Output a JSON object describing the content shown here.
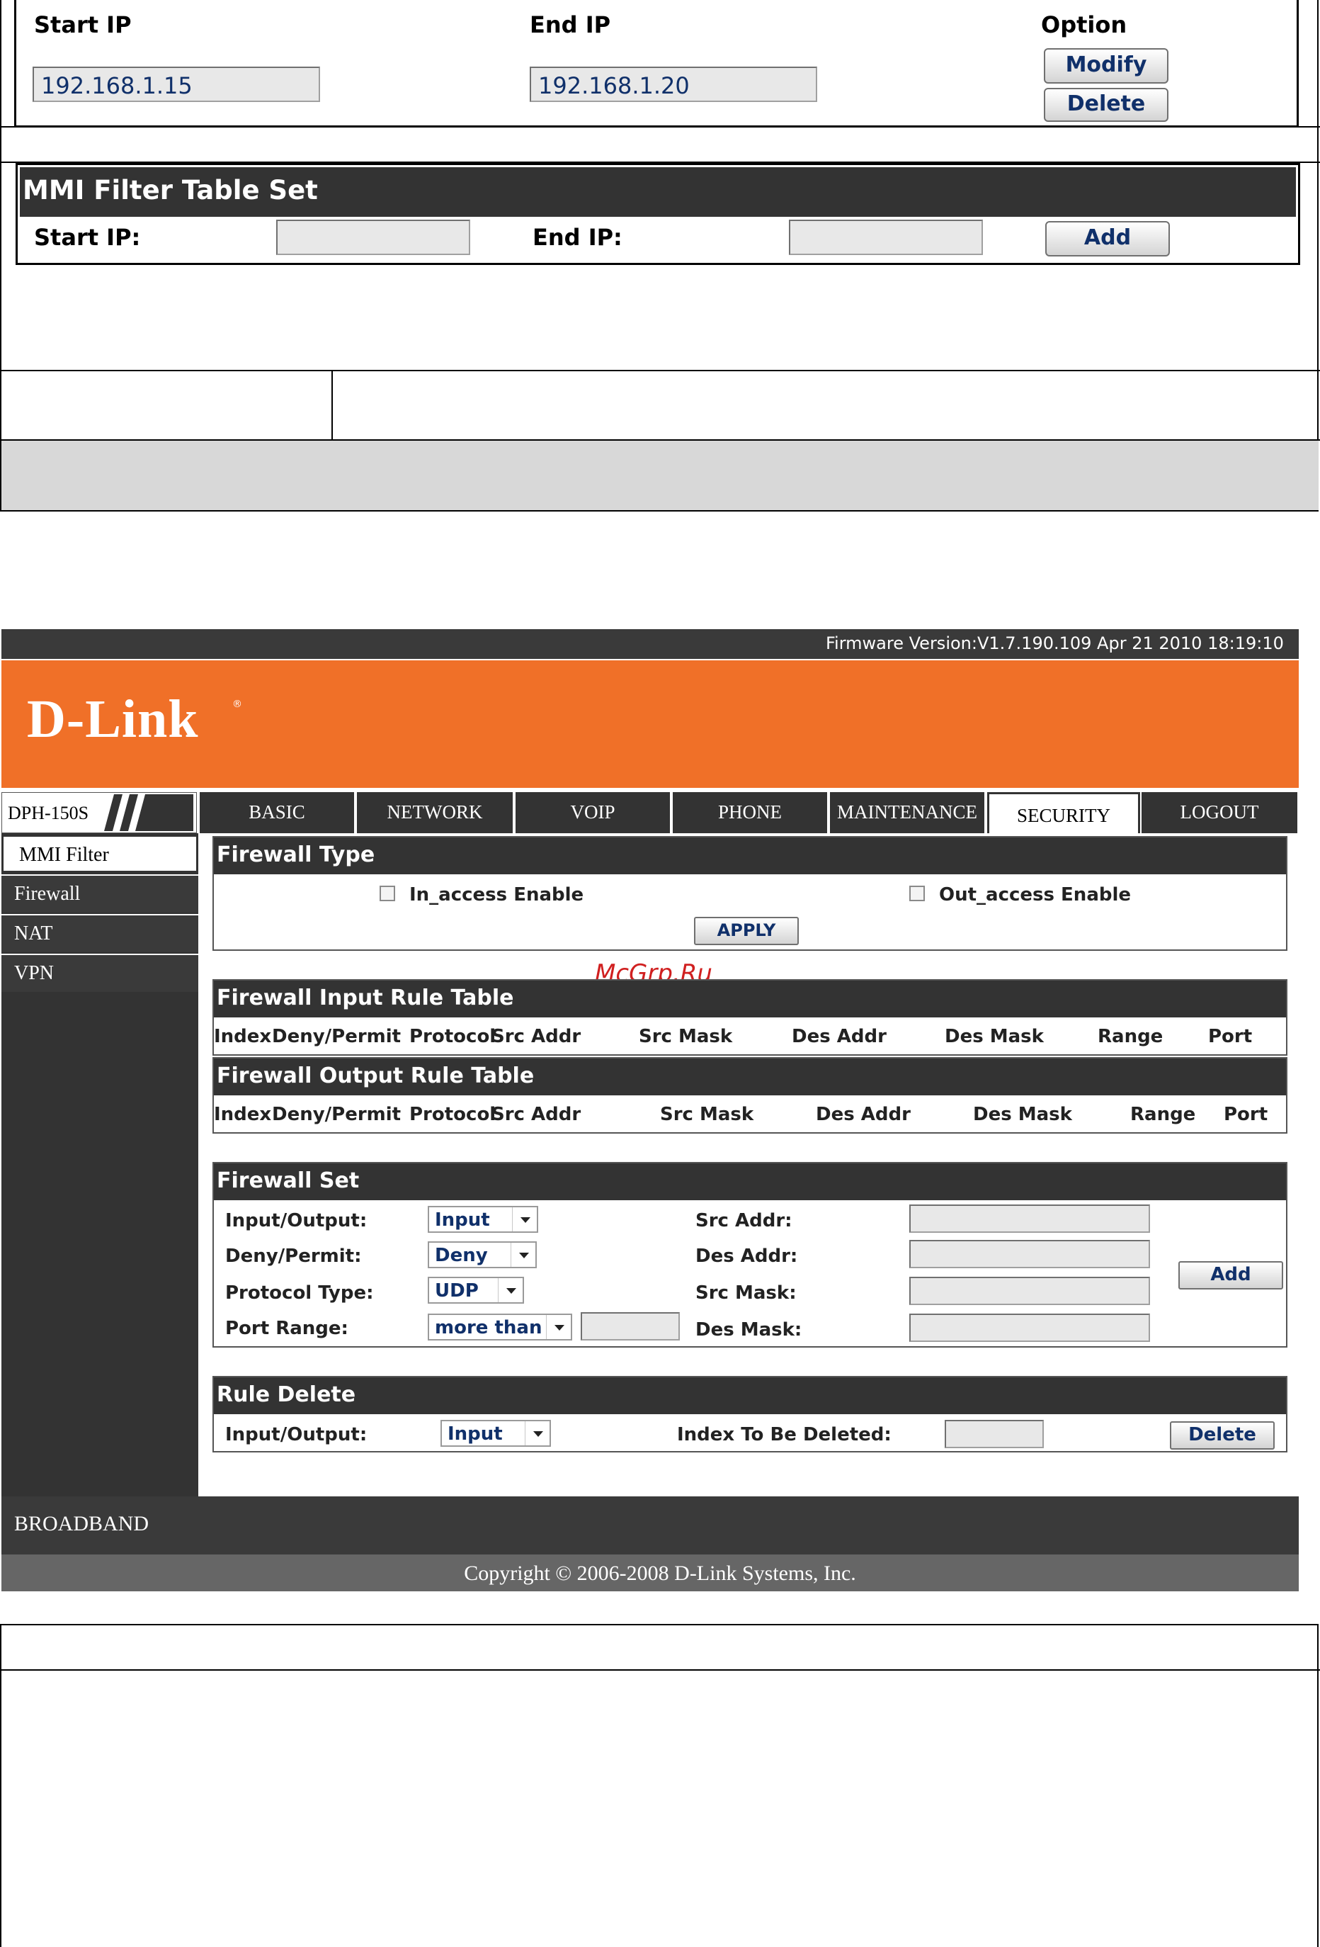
{
  "top_fragment": {
    "headers": {
      "start_ip": "Start IP",
      "end_ip": "End IP",
      "option": "Option"
    },
    "row": {
      "start_ip": "192.168.1.15",
      "end_ip": "192.168.1.20"
    },
    "modify_label": "Modify",
    "delete_label": "Delete",
    "mmi_set": {
      "title": "MMI Filter Table Set",
      "start_ip_label": "Start IP:",
      "end_ip_label": "End IP:",
      "add_label": "Add"
    }
  },
  "screen": {
    "firmware": "Firmware Version:V1.7.190.109 Apr 21 2010 18:19:10",
    "logo": "D-Link",
    "model": "DPH-150S",
    "tabs": [
      {
        "label": "BASIC"
      },
      {
        "label": "NETWORK"
      },
      {
        "label": "VOIP"
      },
      {
        "label": "PHONE"
      },
      {
        "label": "MAINTENANCE"
      },
      {
        "label": "SECURITY"
      },
      {
        "label": "LOGOUT"
      }
    ],
    "active_tab": "SECURITY",
    "sidebar": [
      {
        "label": "MMI Filter"
      },
      {
        "label": "Firewall"
      },
      {
        "label": "NAT"
      },
      {
        "label": "VPN"
      }
    ],
    "active_side": "MMI Filter",
    "firewall_type": {
      "title": "Firewall Type",
      "in_access": "In_access Enable",
      "out_access": "Out_access Enable",
      "apply": "APPLY"
    },
    "watermark": "McGrp.Ru",
    "input_table": {
      "title": "Firewall Input Rule Table",
      "columns": [
        "Index",
        "Deny/Permit",
        "Protocol",
        "Src Addr",
        "Src Mask",
        "Des Addr",
        "Des Mask",
        "Range",
        "Port"
      ]
    },
    "output_table": {
      "title": "Firewall Output Rule Table",
      "columns": [
        "Index",
        "Deny/Permit",
        "Protocol",
        "Src Addr",
        "Src Mask",
        "Des Addr",
        "Des Mask",
        "Range",
        "Port"
      ]
    },
    "firewall_set": {
      "title": "Firewall Set",
      "io_label": "Input/Output:",
      "io_value": "Input",
      "dp_label": "Deny/Permit:",
      "dp_value": "Deny",
      "proto_label": "Protocol Type:",
      "proto_value": "UDP",
      "range_label": "Port Range:",
      "range_value": "more than",
      "src_addr_label": "Src Addr:",
      "des_addr_label": "Des Addr:",
      "src_mask_label": "Src Mask:",
      "des_mask_label": "Des Mask:",
      "add_label": "Add"
    },
    "rule_delete": {
      "title": "Rule Delete",
      "io_label": "Input/Output:",
      "io_value": "Input",
      "index_label": "Index To Be Deleted:",
      "delete_label": "Delete"
    },
    "broadband": "BROADBAND",
    "copyright": "Copyright © 2006-2008 D-Link Systems, Inc."
  }
}
